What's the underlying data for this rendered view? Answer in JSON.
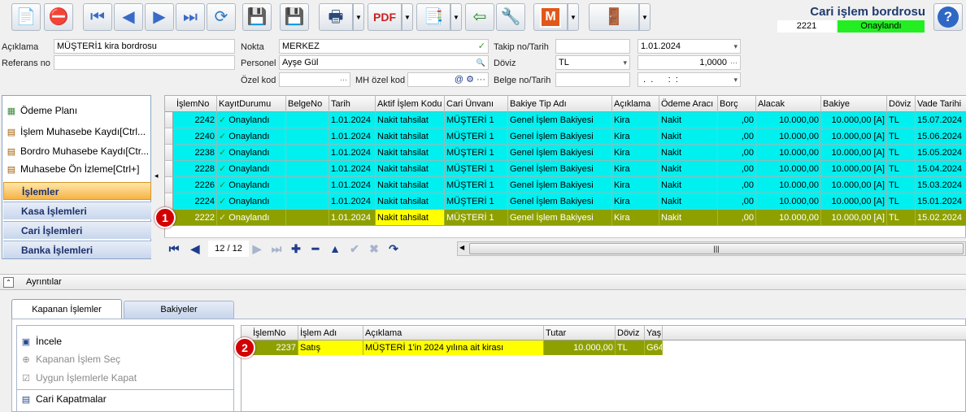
{
  "header": {
    "title": "Cari işlem bordrosu",
    "doc_no": "2221",
    "status": "Onaylandı"
  },
  "toolbar": {
    "buttons": [
      "new-doc-icon",
      "delete-doc-icon",
      "first-icon",
      "prev-icon",
      "next-icon",
      "last-icon",
      "refresh-icon",
      "save-icon",
      "save-close-icon",
      "print-icon",
      "pdf-icon",
      "export-icon",
      "import-icon",
      "tools-icon",
      "m-icon",
      "exit-icon"
    ],
    "m_label": "M"
  },
  "form": {
    "aciklama_label": "Açıklama",
    "aciklama": "MÜŞTERİ1 kira bordrosu",
    "referans_label": "Referans no",
    "referans": "",
    "nokta_label": "Nokta",
    "nokta": "MERKEZ",
    "personel_label": "Personel",
    "personel": "Ayşe Gül",
    "ozelkod_label": "Özel kod",
    "ozelkod": "",
    "mhozelkod_label": "MH özel kod",
    "mhozelkod": "",
    "takip_label": "Takip no/Tarih",
    "takip_no": "",
    "takip_tarih": "1.01.2024",
    "doviz_label": "Döviz",
    "doviz": "TL",
    "kur": "1,0000",
    "belge_label": "Belge no/Tarih",
    "belge_no": "",
    "belge_tarih": " .  .      :  :"
  },
  "nav": {
    "items": [
      "Ödeme Planı",
      "İşlem Muhasebe Kaydı[Ctrl...",
      "Bordro Muhasebe Kaydı[Ctr...",
      "Muhasebe Ön İzleme[Ctrl+]"
    ],
    "groups": [
      "İşlemler",
      "Kasa İşlemleri",
      "Cari İşlemleri",
      "Banka İşlemleri"
    ]
  },
  "grid": {
    "columns": [
      "İşlemNo",
      "KayıtDurumu",
      "BelgeNo",
      "Tarih",
      "Aktif İşlem Kodu",
      "Cari Ünvanı",
      "Bakiye Tip Adı",
      "Açıklama",
      "Ödeme Aracı",
      "Borç",
      "Alacak",
      "Bakiye",
      "Döviz",
      "Vade Tarihi"
    ],
    "rows": [
      [
        "2242",
        "Onaylandı",
        "",
        "1.01.2024",
        "Nakit tahsilat",
        "MÜŞTERİ 1",
        "Genel İşlem Bakiyesi",
        "Kira",
        "Nakit",
        ",00",
        "10.000,00",
        "10.000,00 [A]",
        "TL",
        "15.07.2024"
      ],
      [
        "2240",
        "Onaylandı",
        "",
        "1.01.2024",
        "Nakit tahsilat",
        "MÜŞTERİ 1",
        "Genel İşlem Bakiyesi",
        "Kira",
        "Nakit",
        ",00",
        "10.000,00",
        "10.000,00 [A]",
        "TL",
        "15.06.2024"
      ],
      [
        "2238",
        "Onaylandı",
        "",
        "1.01.2024",
        "Nakit tahsilat",
        "MÜŞTERİ 1",
        "Genel İşlem Bakiyesi",
        "Kira",
        "Nakit",
        ",00",
        "10.000,00",
        "10.000,00 [A]",
        "TL",
        "15.05.2024"
      ],
      [
        "2228",
        "Onaylandı",
        "",
        "1.01.2024",
        "Nakit tahsilat",
        "MÜŞTERİ 1",
        "Genel İşlem Bakiyesi",
        "Kira",
        "Nakit",
        ",00",
        "10.000,00",
        "10.000,00 [A]",
        "TL",
        "15.04.2024"
      ],
      [
        "2226",
        "Onaylandı",
        "",
        "1.01.2024",
        "Nakit tahsilat",
        "MÜŞTERİ 1",
        "Genel İşlem Bakiyesi",
        "Kira",
        "Nakit",
        ",00",
        "10.000,00",
        "10.000,00 [A]",
        "TL",
        "15.03.2024"
      ],
      [
        "2224",
        "Onaylandı",
        "",
        "1.01.2024",
        "Nakit tahsilat",
        "MÜŞTERİ 1",
        "Genel İşlem Bakiyesi",
        "Kira",
        "Nakit",
        ",00",
        "10.000,00",
        "10.000,00 [A]",
        "TL",
        "15.01.2024"
      ],
      [
        "2222",
        "Onaylandı",
        "",
        "1.01.2024",
        "Nakit tahsilat",
        "MÜŞTERİ 1",
        "Genel İşlem Bakiyesi",
        "Kira",
        "Nakit",
        ",00",
        "10.000,00",
        "10.000,00 [A]",
        "TL",
        "15.02.2024"
      ]
    ],
    "selected_row": 6,
    "pager": "12 / 12",
    "badge1": "1"
  },
  "details": {
    "header": "Ayrıntılar",
    "tabs": [
      "Kapanan İşlemler",
      "Bakiyeler"
    ],
    "actions": [
      "İncele",
      "Kapanan İşlem Seç",
      "Uygun İşlemlerle Kapat",
      "Cari Kapatmalar"
    ],
    "columns": [
      "İşlemNo",
      "İşlem Adı",
      "Açıklama",
      "Tutar",
      "Döviz",
      "Yaş"
    ],
    "row": [
      "2237",
      "Satış",
      "MÜŞTERİ 1'in 2024 yılına ait kirası",
      "10.000,00",
      "TL",
      "G64"
    ],
    "badge2": "2"
  },
  "colors": {
    "cyan_row": "#00f0f0",
    "selected_row": "#8ea000",
    "highlight": "#ffff00",
    "status": "#22ee22",
    "badge": "#d20000"
  }
}
